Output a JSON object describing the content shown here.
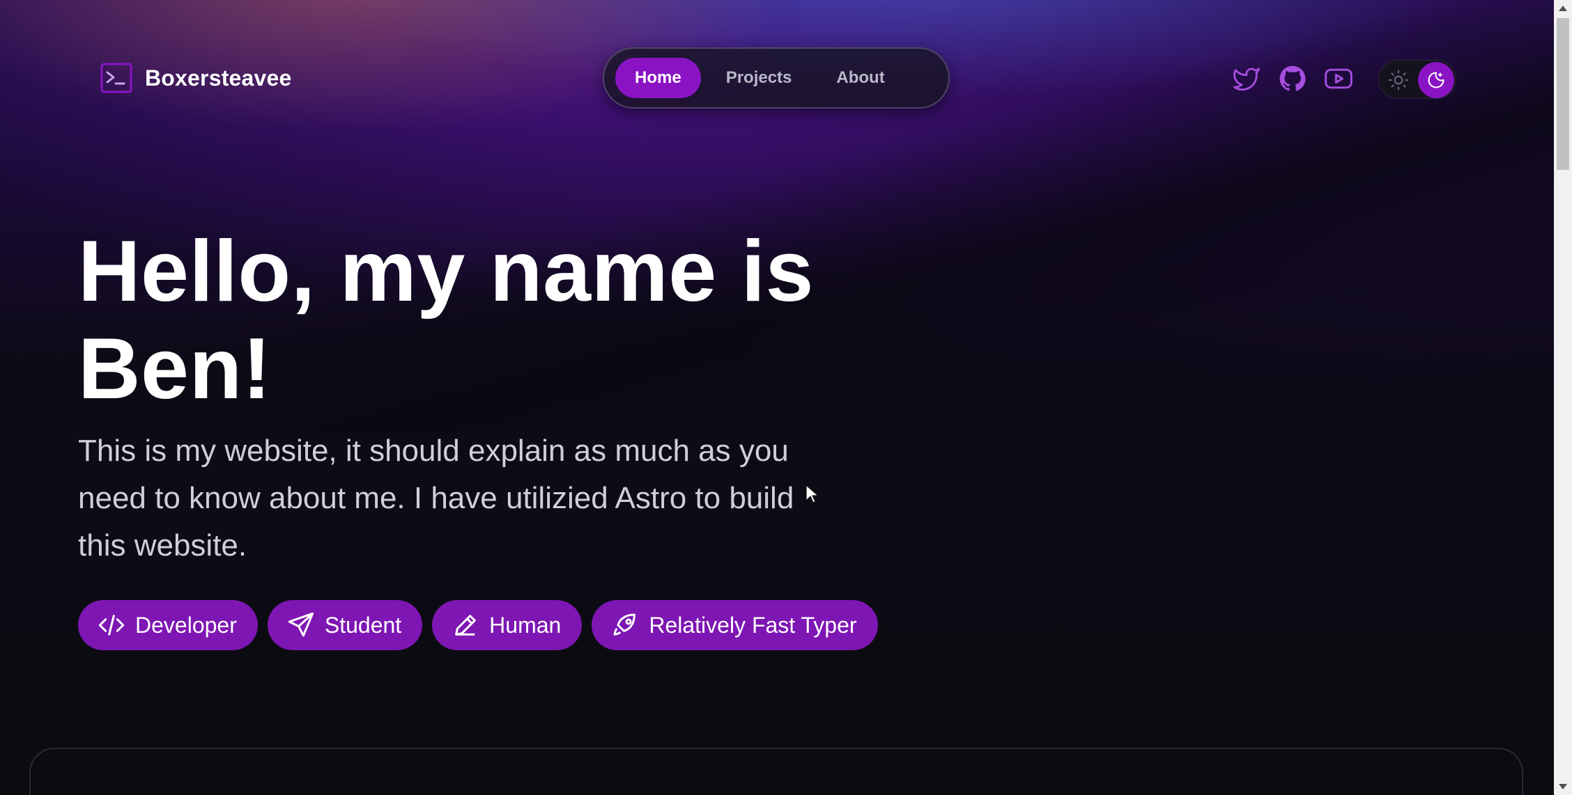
{
  "header": {
    "brand": "Boxersteavee",
    "nav": [
      {
        "label": "Home",
        "active": true
      },
      {
        "label": "Projects",
        "active": false
      },
      {
        "label": "About",
        "active": false
      }
    ],
    "socials": [
      "twitter-icon",
      "github-icon",
      "youtube-icon"
    ],
    "theme": "dark"
  },
  "hero": {
    "title_line1": "Hello, my name is",
    "title_line2": "Ben!",
    "description": "This is my website, it should explain as much as you need to know about me. I have utilizied Astro to build this website.",
    "tags": [
      {
        "label": "Developer",
        "icon": "code-icon"
      },
      {
        "label": "Student",
        "icon": "send-icon"
      },
      {
        "label": "Human",
        "icon": "pencil-icon"
      },
      {
        "label": "Relatively Fast Typer",
        "icon": "rocket-icon"
      }
    ]
  },
  "colors": {
    "accent": "#8a14c4",
    "tag": "#7e16b3",
    "background": "#0b0b10"
  }
}
